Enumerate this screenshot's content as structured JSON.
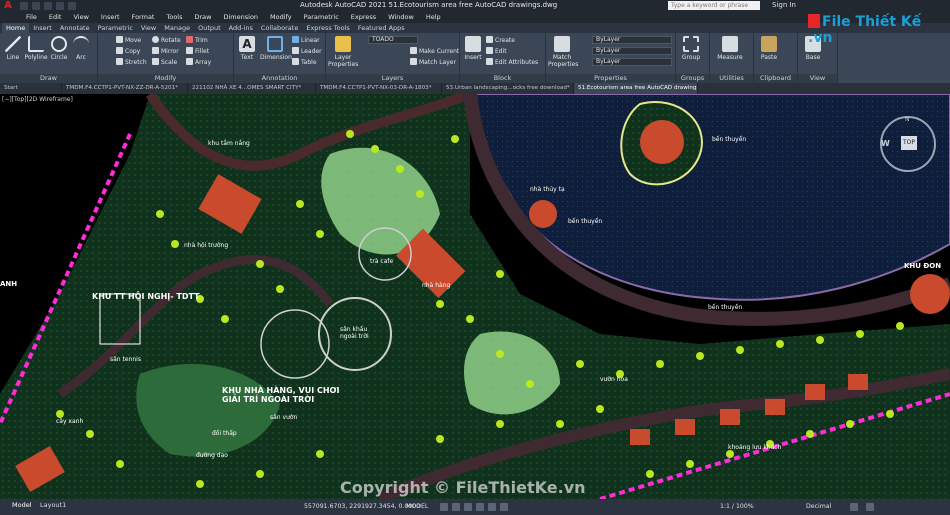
{
  "window": {
    "title": "Autodesk AutoCAD 2021    51.Ecotourism area free AutoCAD drawings.dwg",
    "search_placeholder": "Type a keyword or phrase",
    "sign_in": "Sign In"
  },
  "menu": [
    "File",
    "Edit",
    "View",
    "Insert",
    "Format",
    "Tools",
    "Draw",
    "Dimension",
    "Modify",
    "Parametric",
    "Express",
    "Window",
    "Help"
  ],
  "ribbon_tabs": [
    "Home",
    "Insert",
    "Annotate",
    "Parametric",
    "View",
    "Manage",
    "Output",
    "Add-ins",
    "Collaborate",
    "Express Tools",
    "Featured Apps"
  ],
  "ribbon": {
    "draw": {
      "label": "Draw",
      "tools": [
        "Line",
        "Polyline",
        "Circle",
        "Arc"
      ]
    },
    "modify": {
      "label": "Modify",
      "tools": [
        "Move",
        "Rotate",
        "Trim",
        "Copy",
        "Mirror",
        "Fillet",
        "Stretch",
        "Scale",
        "Array"
      ]
    },
    "annotation": {
      "label": "Annotation",
      "text": "Text",
      "dimension": "Dimension",
      "linear": "Linear",
      "leader": "Leader",
      "table": "Table"
    },
    "layers": {
      "label": "Layers",
      "layer_properties": "Layer Properties",
      "current_layer": "TOADO",
      "make_current": "Make Current",
      "match_layer": "Match Layer"
    },
    "block": {
      "label": "Block",
      "insert": "Insert",
      "create": "Create",
      "edit": "Edit",
      "edit_attributes": "Edit Attributes"
    },
    "properties": {
      "label": "Properties",
      "match": "Match Properties",
      "bylayer1": "ByLayer",
      "bylayer2": "ByLayer",
      "bylayer3": "ByLayer"
    },
    "groups": {
      "label": "Groups",
      "group": "Group"
    },
    "utilities": {
      "label": "Utilities",
      "measure": "Measure"
    },
    "clipboard": {
      "label": "Clipboard",
      "paste": "Paste"
    },
    "view": {
      "label": "View",
      "base": "Base"
    }
  },
  "doc_tabs": [
    "Start",
    "TMDM.F4.CCTP1-PVT-NX-ZZ-DR-A-5201*",
    "221102 NHÀ XE 4...OMES SMART CITY*",
    "TMDM.F4.CCTP1-PVT-NX-03-DR-A-1803*",
    "53.Urban landscaping...ocks free download*",
    "51.Ecotourism area free AutoCAD drawings*"
  ],
  "viewport": {
    "label": "[−][Top][2D Wireframe]",
    "viewcube_top": "TOP",
    "viewcube_w": "W",
    "viewcube_n": "N",
    "left_edge": "ANH",
    "right_edge": "KHU ĐON",
    "labels": [
      {
        "text": "khu tắm nắng",
        "big": false
      },
      {
        "text": "sân khấu\nngoài trời",
        "big": false
      },
      {
        "text": "nhà hàng",
        "big": false
      },
      {
        "text": "nhà thủy tạ",
        "big": false
      },
      {
        "text": "bến thuyền",
        "big": false
      },
      {
        "text": "bến thuyền",
        "big": false
      },
      {
        "text": "bến thuyền",
        "big": false
      },
      {
        "text": "KHU TT HỘI NGHỊ- TDTT",
        "big": true
      },
      {
        "text": "KHU NHÀ HÀNG, VUI CHƠI\nGIẢI TRÍ NGOÀI TRỜI",
        "big": true
      },
      {
        "text": "sân tennis",
        "big": false
      },
      {
        "text": "nhà hội trường",
        "big": false
      },
      {
        "text": "vườn hoa",
        "big": false
      },
      {
        "text": "đồi thấp",
        "big": false
      },
      {
        "text": "đường dạo",
        "big": false
      },
      {
        "text": "cây xanh",
        "big": false
      },
      {
        "text": "khoảng lưu khách",
        "big": false
      },
      {
        "text": "trà cafe",
        "big": false
      },
      {
        "text": "sân vườn",
        "big": false
      }
    ],
    "watermark": "Copyright © FileThietKe.vn",
    "logo": "File Thiết Kế .vn"
  },
  "status": {
    "model_tab": "Model",
    "layout_tab": "Layout1",
    "coordinates": "557091.6703, 2291927.3454, 0.0000",
    "mode": "MODEL",
    "scale": "1:1 / 100%",
    "units": "Decimal"
  }
}
